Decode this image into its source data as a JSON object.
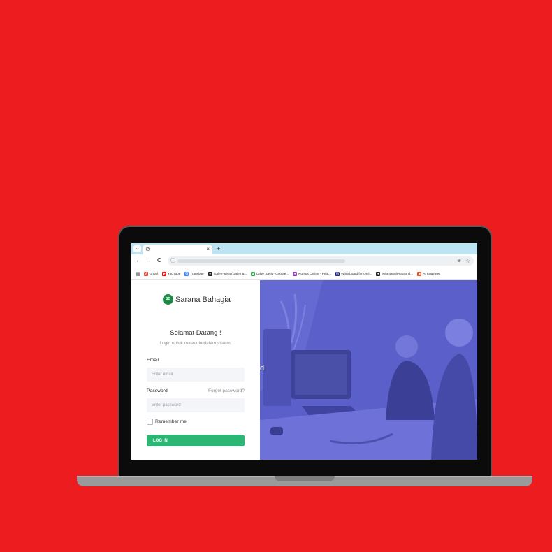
{
  "browser": {
    "tab_favicon": "⊘",
    "tab_close": "×",
    "new_tab": "+",
    "tab_search": "⌄",
    "nav_back": "←",
    "nav_forward": "→",
    "nav_reload": "C",
    "omnibox_info": "ⓘ",
    "zoom_icon": "⊕",
    "bookmark_star": "☆",
    "apps_icon": "▦",
    "bookmarks": [
      {
        "label": "Gmail",
        "icon": "gmail-icon",
        "color": "#EA4335",
        "glyph": "M"
      },
      {
        "label": "YouTube",
        "icon": "youtube-icon",
        "color": "#FF0000",
        "glyph": "▶"
      },
      {
        "label": "Translate",
        "icon": "translate-icon",
        "color": "#4285F4",
        "glyph": "G"
      },
      {
        "label": "Galeh-ariya (Galeh a...",
        "icon": "github-icon",
        "color": "#222222",
        "glyph": "●"
      },
      {
        "label": "Drive Saya - Google...",
        "icon": "drive-icon",
        "color": "#34A853",
        "glyph": "▲"
      },
      {
        "label": "Kursus Online - Pela...",
        "icon": "course-icon",
        "color": "#8E44AD",
        "glyph": "●"
      },
      {
        "label": "Whiteboard for Onli...",
        "icon": "whiteboard-icon",
        "color": "#1A237E",
        "glyph": "W"
      },
      {
        "label": "evianta08/PENSInd...",
        "icon": "github-icon",
        "color": "#222222",
        "glyph": "●"
      },
      {
        "label": "AI Engineer",
        "icon": "microsoft-icon",
        "color": "#F25022",
        "glyph": "■"
      }
    ]
  },
  "login": {
    "brand_logo": "SB",
    "brand_name": "Sarana Bahagia",
    "welcome": "Selamat Datang !",
    "subtitle": "Login untuk masuk kedalam sistem.",
    "email_label": "Email",
    "email_placeholder": "Enter email",
    "password_label": "Password",
    "forgot_password": "Forgot password?",
    "password_placeholder": "Enter password",
    "remember_me": "Remember me",
    "login_button": "LOG IN"
  },
  "hero": {
    "overlay_color": "#5B5FC9",
    "partial_text": "d"
  },
  "colors": {
    "background": "#ED1C1F",
    "primary_button": "#2BB673",
    "tab_bar": "#BDE4F1"
  }
}
